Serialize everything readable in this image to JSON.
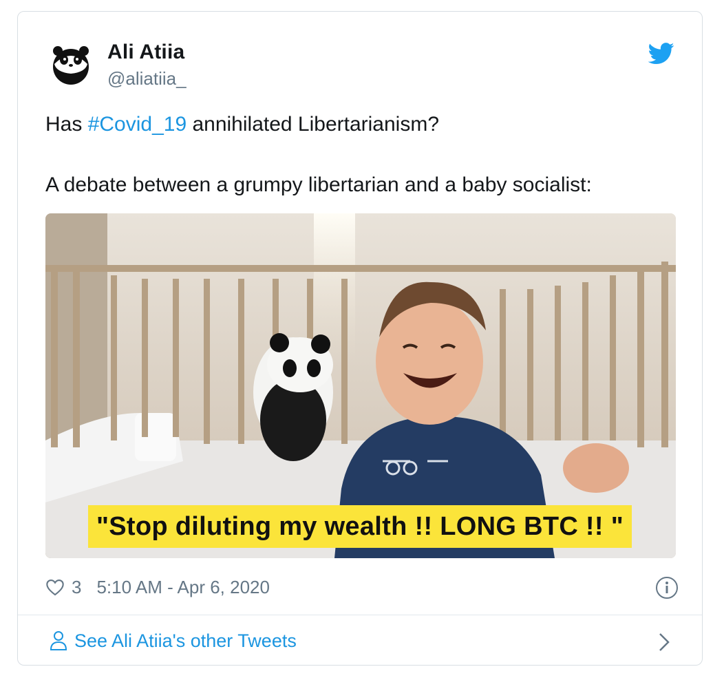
{
  "author": {
    "name": "Ali Atiia",
    "handle": "@aliatiia_"
  },
  "tweet": {
    "text_prefix": "Has ",
    "hashtag": "#Covid_19",
    "text_suffix": " annihilated Libertarianism?",
    "line2": "A debate between a grumpy libertarian and a baby socialist:"
  },
  "media": {
    "caption": "\"Stop diluting my wealth !! LONG BTC !! \""
  },
  "meta": {
    "likes": "3",
    "timestamp": "5:10 AM - Apr 6, 2020"
  },
  "footer": {
    "link": "See Ali Atiia's other Tweets"
  },
  "icons": {
    "brand": "twitter-bird-icon",
    "like": "heart-icon",
    "info": "info-icon",
    "profile": "person-icon",
    "more": "chevron-right-icon"
  },
  "colors": {
    "accent": "#1b95e0",
    "secondary_text": "#657786",
    "caption_bg": "#fbe43a"
  }
}
